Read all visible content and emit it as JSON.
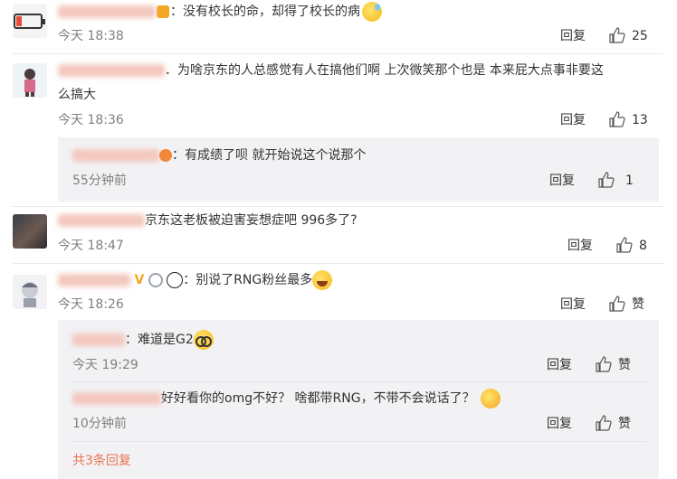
{
  "comments": [
    {
      "text": "：没有校长的命，却得了校长的病",
      "time": "今天 18:38",
      "reply_label": "回复",
      "likes": "25"
    },
    {
      "text": "．为啥京东的人总感觉有人在搞他们啊 上次微笑那个也是 本来屁大点事非要这",
      "text_cont": "么搞大",
      "time": "今天 18:36",
      "reply_label": "回复",
      "likes": "13",
      "sub_reply": {
        "text": "：有成绩了呗 就开始说这个说那个",
        "time": "55分钟前",
        "reply_label": "回复",
        "likes": "1"
      }
    },
    {
      "text": "京东这老板被迫害妄想症吧 996多了?",
      "time": "今天 18:47",
      "reply_label": "回复",
      "likes": "8"
    },
    {
      "text": "：别说了RNG粉丝最多",
      "time": "今天 18:26",
      "reply_label": "回复",
      "likes": "赞",
      "sub_replies": [
        {
          "text": "：难道是G2",
          "time": "今天 19:29",
          "reply_label": "回复",
          "likes": "赞"
        },
        {
          "text": "好好看你的omg不好？  啥都带RNG，不带不会说话了？",
          "time": "10分钟前",
          "reply_label": "回复",
          "likes": "赞"
        }
      ],
      "more_replies": "共3条回复"
    }
  ],
  "colors": {
    "accent": "#eb7350",
    "meta": "#808080",
    "sub_bg": "#f2f2f5"
  }
}
